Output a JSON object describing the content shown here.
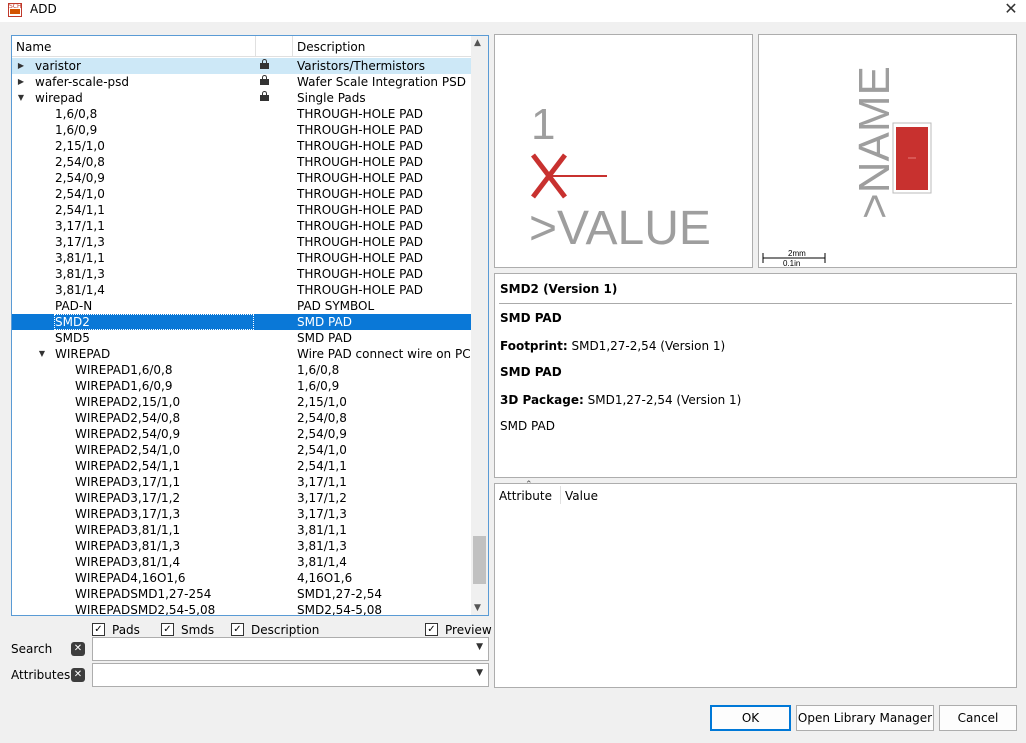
{
  "window": {
    "title": "ADD",
    "icon": "app-schematic-icon",
    "close_icon": "close-icon"
  },
  "tree": {
    "columns": {
      "name": "Name",
      "description": "Description"
    },
    "rows": [
      {
        "name": "varistor",
        "description": "Varistors/Thermistors",
        "level": 0,
        "expander": "collapsed",
        "locked": true,
        "state": "hover"
      },
      {
        "name": "wafer-scale-psd",
        "description": "Wafer Scale Integration PSD ...",
        "level": 0,
        "expander": "collapsed",
        "locked": true
      },
      {
        "name": "wirepad",
        "description": "Single Pads",
        "level": 0,
        "expander": "expanded",
        "locked": true
      },
      {
        "name": "1,6/0,8",
        "description": "THROUGH-HOLE PAD",
        "level": 1
      },
      {
        "name": "1,6/0,9",
        "description": "THROUGH-HOLE PAD",
        "level": 1
      },
      {
        "name": "2,15/1,0",
        "description": "THROUGH-HOLE PAD",
        "level": 1
      },
      {
        "name": "2,54/0,8",
        "description": "THROUGH-HOLE PAD",
        "level": 1
      },
      {
        "name": "2,54/0,9",
        "description": "THROUGH-HOLE PAD",
        "level": 1
      },
      {
        "name": "2,54/1,0",
        "description": "THROUGH-HOLE PAD",
        "level": 1
      },
      {
        "name": "2,54/1,1",
        "description": "THROUGH-HOLE PAD",
        "level": 1
      },
      {
        "name": "3,17/1,1",
        "description": "THROUGH-HOLE PAD",
        "level": 1
      },
      {
        "name": "3,17/1,3",
        "description": "THROUGH-HOLE PAD",
        "level": 1
      },
      {
        "name": "3,81/1,1",
        "description": "THROUGH-HOLE PAD",
        "level": 1
      },
      {
        "name": "3,81/1,3",
        "description": "THROUGH-HOLE PAD",
        "level": 1
      },
      {
        "name": "3,81/1,4",
        "description": "THROUGH-HOLE PAD",
        "level": 1
      },
      {
        "name": "PAD-N",
        "description": "PAD SYMBOL",
        "level": 1
      },
      {
        "name": "SMD2",
        "description": "SMD PAD",
        "level": 1,
        "state": "selected"
      },
      {
        "name": "SMD5",
        "description": "SMD PAD",
        "level": 1
      },
      {
        "name": "WIREPAD",
        "description": "Wire PAD connect wire on PCB",
        "level": 1,
        "expander": "expanded"
      },
      {
        "name": "WIREPAD1,6/0,8",
        "description": "1,6/0,8",
        "level": 2
      },
      {
        "name": "WIREPAD1,6/0,9",
        "description": "1,6/0,9",
        "level": 2
      },
      {
        "name": "WIREPAD2,15/1,0",
        "description": "2,15/1,0",
        "level": 2
      },
      {
        "name": "WIREPAD2,54/0,8",
        "description": "2,54/0,8",
        "level": 2
      },
      {
        "name": "WIREPAD2,54/0,9",
        "description": "2,54/0,9",
        "level": 2
      },
      {
        "name": "WIREPAD2,54/1,0",
        "description": "2,54/1,0",
        "level": 2
      },
      {
        "name": "WIREPAD2,54/1,1",
        "description": "2,54/1,1",
        "level": 2
      },
      {
        "name": "WIREPAD3,17/1,1",
        "description": "3,17/1,1",
        "level": 2
      },
      {
        "name": "WIREPAD3,17/1,2",
        "description": "3,17/1,2",
        "level": 2
      },
      {
        "name": "WIREPAD3,17/1,3",
        "description": "3,17/1,3",
        "level": 2
      },
      {
        "name": "WIREPAD3,81/1,1",
        "description": "3,81/1,1",
        "level": 2
      },
      {
        "name": "WIREPAD3,81/1,3",
        "description": "3,81/1,3",
        "level": 2
      },
      {
        "name": "WIREPAD3,81/1,4",
        "description": "3,81/1,4",
        "level": 2
      },
      {
        "name": "WIREPAD4,16O1,6",
        "description": "4,16O1,6",
        "level": 2
      },
      {
        "name": "WIREPADSMD1,27-254",
        "description": "SMD1,27-2,54",
        "level": 2
      },
      {
        "name": "WIREPADSMD2,54-5,08",
        "description": "SMD2,54-5,08",
        "level": 2
      }
    ]
  },
  "filters": {
    "pads": {
      "label": "Pads",
      "checked": true
    },
    "smds": {
      "label": "Smds",
      "checked": true
    },
    "description": {
      "label": "Description",
      "checked": true
    },
    "preview": {
      "label": "Preview",
      "checked": true
    }
  },
  "search": {
    "label": "Search",
    "value": ""
  },
  "attributes_filter": {
    "label": "Attributes",
    "value": ""
  },
  "symbol_preview": {
    "pin_number": "1",
    "value_text": ">VALUE"
  },
  "footprint_preview": {
    "name_text": ">NAME",
    "scale_mm": "2mm",
    "scale_in": "0.1in"
  },
  "info": {
    "title": "SMD2 (Version 1)",
    "device_desc": "SMD PAD",
    "footprint_label": "Footprint:",
    "footprint_value": "SMD1,27-2,54 (Version 1)",
    "footprint_desc": "SMD PAD",
    "package_label": "3D Package:",
    "package_value": "SMD1,27-2,54 (Version 1)",
    "package_desc": "SMD PAD"
  },
  "attributes_table": {
    "col_attribute": "Attribute",
    "col_value": "Value"
  },
  "buttons": {
    "ok": "OK",
    "library_manager": "Open Library Manager",
    "cancel": "Cancel"
  },
  "colors": {
    "selection": "#0a78d7",
    "hover": "#cde8f7",
    "symbol_red": "#c8312f",
    "pad_fill": "#c8312f"
  }
}
